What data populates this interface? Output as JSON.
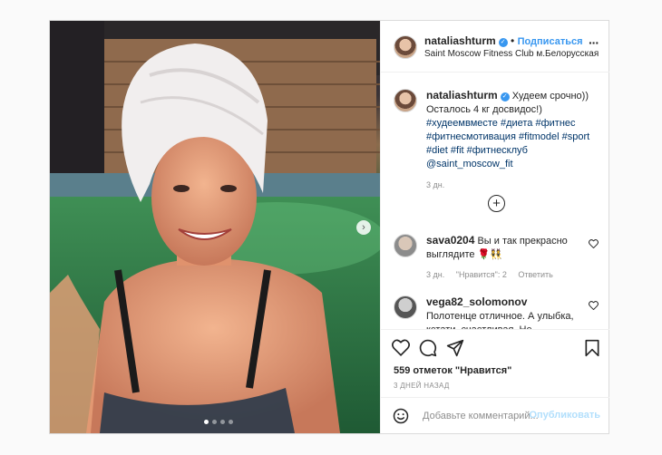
{
  "post": {
    "author": {
      "username": "nataliashturm",
      "verified": true,
      "follow_label": "Подписаться",
      "location": "Saint Moscow Fitness Club м.Белорусская"
    },
    "photo": {
      "description_icon": "photo-selfie-pool",
      "carousel_dots": 4,
      "active_dot": 1,
      "next_icon": "chevron-right-icon"
    },
    "caption": {
      "username": "nataliashturm",
      "text_lead": "Худеем срочно))",
      "text_line2": "Осталось 4 кг досвидос!)",
      "tags_line1": "#худеемвместе #диета #фитнес",
      "tags_line2": "#фитнесмотивация #fitmodel #sport",
      "tags_line3": "#diet #fit #фитнесклуб",
      "mention": "@saint_moscow_fit",
      "time": "3 дн."
    },
    "load_more_icon": "plus-circle-icon",
    "comments": [
      {
        "username": "sava0204",
        "text": "Вы и так прекрасно выглядите 🌹👯",
        "time": "3 дн.",
        "likes_label": "\"Нравится\": 2",
        "reply_label": "Ответить"
      },
      {
        "username": "vega82_solomonov",
        "text": "Полотенце отличное. А улыбка, кстати, счастливая. Не натянутая, не"
      }
    ],
    "likes_text": "559 отметок \"Нравится\"",
    "date_text": "3 ДНЕЙ НАЗАД",
    "comment_placeholder": "Добавьте комментарий...",
    "publish_label": "Опубликовать",
    "colors": {
      "link": "#3897f0",
      "hashtag": "#003569",
      "muted": "#8e8e8e",
      "publish_disabled": "#b2dffc"
    }
  }
}
